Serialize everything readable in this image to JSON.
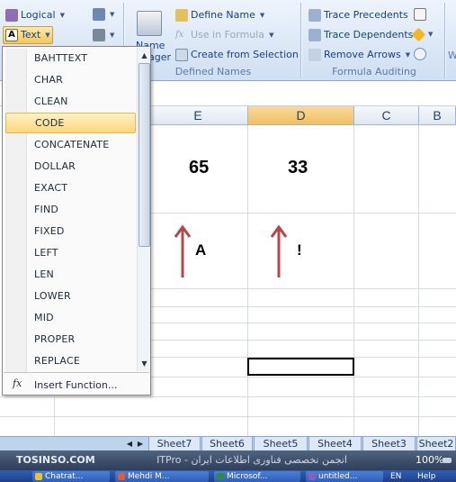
{
  "ribbon": {
    "logical_label": "Logical",
    "text_label": "Text",
    "define_name": "Define Name",
    "use_in_formula": "Use in Formula",
    "create_from_selection": "Create from Selection",
    "name_manager_partial_1": "Name",
    "name_manager_partial_2": "ager",
    "group_defined_names": "Defined Names",
    "trace_precedents": "Trace Precedents",
    "trace_dependents": "Trace Dependents",
    "remove_arrows": "Remove Arrows",
    "group_formula_auditing": "Formula Auditing",
    "right_edge_letters": "W"
  },
  "menu": {
    "items": [
      "BAHTTEXT",
      "CHAR",
      "CLEAN",
      "CODE",
      "CONCATENATE",
      "DOLLAR",
      "EXACT",
      "FIND",
      "FIXED",
      "LEFT",
      "LEN",
      "LOWER",
      "MID",
      "PROPER",
      "REPLACE"
    ],
    "highlighted": "CODE",
    "insert_function": "Insert Function..."
  },
  "sheet": {
    "columns": [
      "E",
      "D",
      "C",
      "B"
    ],
    "selected_column": "D",
    "values": {
      "e_row": "65",
      "d_row": "33",
      "e_char": "A",
      "d_char": "!"
    }
  },
  "tabs": [
    "Sheet7",
    "Sheet6",
    "Sheet5",
    "Sheet4",
    "Sheet3",
    "Sheet2"
  ],
  "status": {
    "site_left": "TOSINSO.COM",
    "watermark_center": "ITPro - انجمن تخصصی فناوری اطلاعات ایران",
    "zoom": "100%"
  },
  "taskbar": {
    "items": [
      "Chatrat...",
      "Mehdi M...",
      "Microsof...",
      "untitled...",
      "EN",
      "Help"
    ]
  },
  "colors": {
    "arrow": "#b5474a",
    "accent_highlight": "#fbd87c",
    "ribbon_text": "#15428b"
  }
}
